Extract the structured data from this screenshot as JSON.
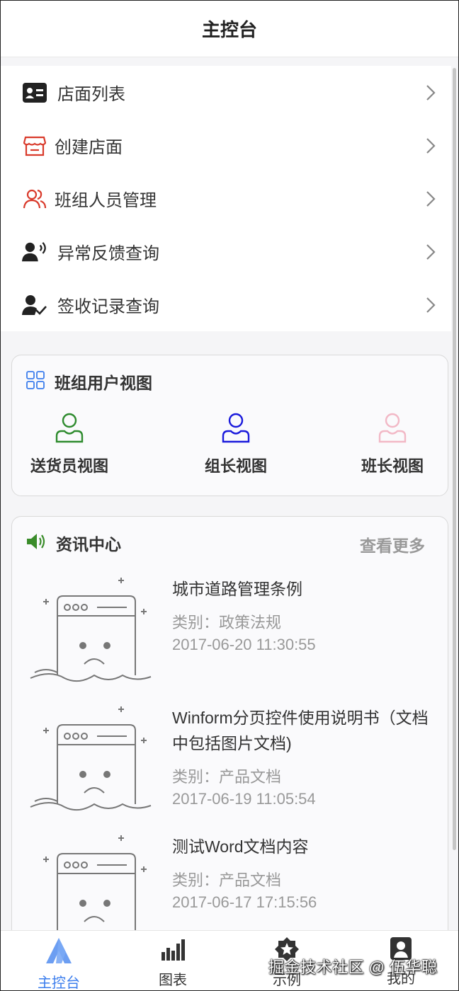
{
  "header": {
    "title": "主控台"
  },
  "menu": [
    {
      "label": "店面列表",
      "icon": "contact-card-icon",
      "color": "#222222"
    },
    {
      "label": "创建店面",
      "icon": "storefront-icon",
      "color": "#d93a2b"
    },
    {
      "label": "班组人员管理",
      "icon": "team-people-icon",
      "color": "#d93a2b"
    },
    {
      "label": "异常反馈查询",
      "icon": "user-voice-icon",
      "color": "#222222"
    },
    {
      "label": "签收记录查询",
      "icon": "user-check-icon",
      "color": "#222222"
    }
  ],
  "team_view": {
    "title": "班组用户视图",
    "icon_color": "#3b7ded",
    "views": [
      {
        "label": "送货员视图",
        "color": "#2e8b2e"
      },
      {
        "label": "组长视图",
        "color": "#1a1adc"
      },
      {
        "label": "班长视图",
        "color": "#f2b8c6"
      }
    ]
  },
  "news": {
    "title": "资讯中心",
    "more": "查看更多",
    "icon_color": "#3a8c2a",
    "items": [
      {
        "title": "城市道路管理条例",
        "category": "类别：政策法规",
        "date": "2017-06-20 11:30:55"
      },
      {
        "title": "Winform分页控件使用说明书（文档中包括图片文档)",
        "category": "类别：产品文档",
        "date": "2017-06-19 11:05:54"
      },
      {
        "title": "测试Word文档内容",
        "category": "类别：产品文档",
        "date": "2017-06-17 17:15:56"
      }
    ]
  },
  "tabs": [
    {
      "label": "主控台",
      "active": true
    },
    {
      "label": "图表",
      "active": false
    },
    {
      "label": "示例",
      "active": false
    },
    {
      "label": "我的",
      "active": false
    }
  ],
  "watermark": "掘金技术社区 @ 伍华聪",
  "accent_color": "#3b7ded"
}
